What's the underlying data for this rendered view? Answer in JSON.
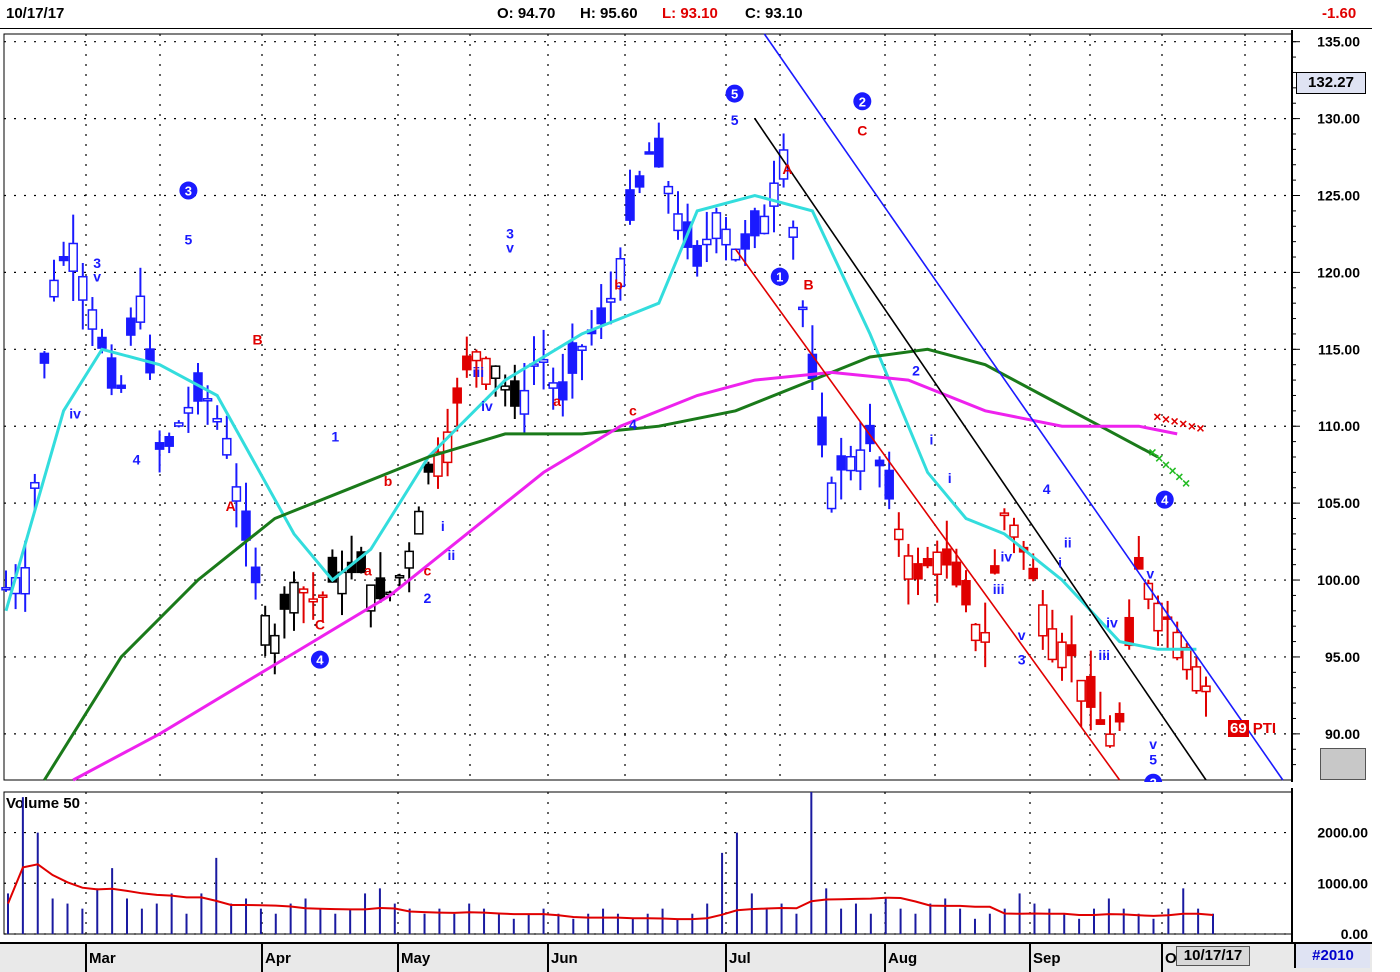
{
  "header": {
    "date": "10/17/17",
    "open": "O: 94.70",
    "high": "H: 95.60",
    "low": "L: 93.10",
    "close": "C: 93.10",
    "change": "-1.60"
  },
  "price_tag": "132.27",
  "ticker": {
    "num": "69",
    "symbol": "PTI"
  },
  "volume_label": "Volume 50",
  "footer": {
    "date": "10/17/17",
    "id": "#2010"
  },
  "colors": {
    "up_bar": "#1a1aff",
    "down_bar": "#e00000",
    "neutral_bar": "#000000",
    "sma_fast": "#33dddd",
    "sma_mid": "#1a7a1a",
    "sma_slow": "#ee22ee",
    "channel_upper": "#1a1aff",
    "channel_mid": "#000000",
    "channel_lower": "#e00000"
  },
  "chart_data": [
    {
      "type": "candlestick",
      "title": "",
      "x_months": [
        "Mar",
        "Apr",
        "May",
        "Jun",
        "Jul",
        "Aug",
        "Sep",
        "O"
      ],
      "y_ticks": [
        "135.00",
        "130.00",
        "125.00",
        "120.00",
        "115.00",
        "110.00",
        "105.00",
        "100.00",
        "95.00",
        "90.00"
      ],
      "ylim": [
        87,
        135.5
      ],
      "grid": true,
      "close_series": [
        {
          "date": "2017-02-15",
          "close": 99.5
        },
        {
          "date": "2017-02-22",
          "close": 101
        },
        {
          "date": "2017-03-01",
          "close": 119
        },
        {
          "date": "2017-03-08",
          "close": 122
        },
        {
          "date": "2017-03-15",
          "close": 117
        },
        {
          "date": "2017-03-22",
          "close": 111
        },
        {
          "date": "2017-03-29",
          "close": 119
        },
        {
          "date": "2017-04-03",
          "close": 107.5
        },
        {
          "date": "2017-04-06",
          "close": 111
        },
        {
          "date": "2017-04-10",
          "close": 112
        },
        {
          "date": "2017-04-14",
          "close": 109
        },
        {
          "date": "2017-04-20",
          "close": 101
        },
        {
          "date": "2017-04-24",
          "close": 96
        },
        {
          "date": "2017-04-28",
          "close": 100
        },
        {
          "date": "2017-05-02",
          "close": 98.5
        },
        {
          "date": "2017-05-08",
          "close": 100.5
        },
        {
          "date": "2017-05-12",
          "close": 100.5
        },
        {
          "date": "2017-05-18",
          "close": 98.5
        },
        {
          "date": "2017-05-22",
          "close": 101
        },
        {
          "date": "2017-05-26",
          "close": 107
        },
        {
          "date": "2017-05-31",
          "close": 110
        },
        {
          "date": "2017-06-05",
          "close": 115
        },
        {
          "date": "2017-06-12",
          "close": 114
        },
        {
          "date": "2017-06-16",
          "close": 111
        },
        {
          "date": "2017-06-22",
          "close": 115
        },
        {
          "date": "2017-06-28",
          "close": 111.5
        },
        {
          "date": "2017-07-05",
          "close": 115.5
        },
        {
          "date": "2017-07-10",
          "close": 117
        },
        {
          "date": "2017-07-14",
          "close": 123
        },
        {
          "date": "2017-07-18",
          "close": 128
        },
        {
          "date": "2017-07-21",
          "close": 125
        },
        {
          "date": "2017-07-25",
          "close": 120
        },
        {
          "date": "2017-07-28",
          "close": 124
        },
        {
          "date": "2017-08-02",
          "close": 121
        },
        {
          "date": "2017-08-07",
          "close": 123
        },
        {
          "date": "2017-08-10",
          "close": 128
        },
        {
          "date": "2017-08-12",
          "close": 116
        },
        {
          "date": "2017-08-16",
          "close": 106
        },
        {
          "date": "2017-08-20",
          "close": 108
        },
        {
          "date": "2017-08-24",
          "close": 109
        },
        {
          "date": "2017-08-28",
          "close": 104
        },
        {
          "date": "2017-09-01",
          "close": 100
        },
        {
          "date": "2017-09-06",
          "close": 102
        },
        {
          "date": "2017-09-10",
          "close": 99
        },
        {
          "date": "2017-09-14",
          "close": 96
        },
        {
          "date": "2017-09-18",
          "close": 105
        },
        {
          "date": "2017-09-22",
          "close": 101
        },
        {
          "date": "2017-09-26",
          "close": 97
        },
        {
          "date": "2017-09-30",
          "close": 95
        },
        {
          "date": "2017-10-03",
          "close": 91
        },
        {
          "date": "2017-10-06",
          "close": 89.5
        },
        {
          "date": "2017-10-09",
          "close": 101
        },
        {
          "date": "2017-10-12",
          "close": 98
        },
        {
          "date": "2017-10-15",
          "close": 96
        },
        {
          "date": "2017-10-17",
          "close": 93.1
        }
      ],
      "moving_averages": [
        {
          "color": "#33dddd",
          "points": [
            [
              0,
              98
            ],
            [
              6,
              111
            ],
            [
              10,
              115
            ],
            [
              16,
              114
            ],
            [
              22,
              112
            ],
            [
              30,
              103
            ],
            [
              34,
              100
            ],
            [
              38,
              102
            ],
            [
              44,
              108
            ],
            [
              52,
              113
            ],
            [
              60,
              116
            ],
            [
              68,
              118
            ],
            [
              72,
              124
            ],
            [
              78,
              125
            ],
            [
              84,
              124
            ],
            [
              90,
              116
            ],
            [
              96,
              107
            ],
            [
              100,
              104
            ],
            [
              104,
              103
            ],
            [
              110,
              100
            ],
            [
              116,
              96
            ],
            [
              120,
              95.5
            ],
            [
              124,
              95.5
            ]
          ]
        },
        {
          "color": "#1a7a1a",
          "points": [
            [
              4,
              87
            ],
            [
              12,
              95
            ],
            [
              20,
              100
            ],
            [
              28,
              104
            ],
            [
              36,
              106
            ],
            [
              44,
              108
            ],
            [
              52,
              109.5
            ],
            [
              60,
              109.5
            ],
            [
              68,
              110
            ],
            [
              76,
              111
            ],
            [
              84,
              113
            ],
            [
              90,
              114.5
            ],
            [
              96,
              115
            ],
            [
              102,
              114
            ],
            [
              108,
              112
            ],
            [
              114,
              110
            ],
            [
              120,
              108
            ]
          ]
        },
        {
          "color": "#ee22ee",
          "points": [
            [
              7,
              87
            ],
            [
              16,
              90
            ],
            [
              24,
              93
            ],
            [
              32,
              96
            ],
            [
              40,
              99
            ],
            [
              48,
              103
            ],
            [
              56,
              107
            ],
            [
              64,
              110
            ],
            [
              72,
              112
            ],
            [
              78,
              113
            ],
            [
              86,
              113.5
            ],
            [
              94,
              113
            ],
            [
              102,
              111
            ],
            [
              110,
              110
            ],
            [
              118,
              110
            ],
            [
              122,
              109.5
            ]
          ]
        }
      ],
      "wave_labels": [
        "3",
        "5",
        "3",
        "v",
        "iv",
        "4",
        "B",
        "A",
        "C",
        "4",
        "1",
        "b",
        "a",
        "c",
        "2",
        "i",
        "ii",
        "iii",
        "iv",
        "3",
        "v",
        "a",
        "c",
        "4",
        "b",
        "5",
        "5",
        "A",
        "1",
        "B",
        "2",
        "C",
        "2",
        "i",
        "i",
        "4",
        "ii",
        "iv",
        "iii",
        "v",
        "3",
        "i",
        "iv",
        "iii",
        "4",
        "v",
        "v",
        "5",
        "3"
      ]
    },
    {
      "type": "bar",
      "title": "Volume 50",
      "y_ticks": [
        "2000.00",
        "1000.00",
        "0.00"
      ],
      "ylim": [
        0,
        2800
      ],
      "values_approx": [
        800,
        2700,
        2000,
        700,
        600,
        500,
        900,
        1300,
        700,
        500,
        600,
        800,
        400,
        800,
        1500,
        600,
        700,
        500,
        400,
        600,
        700,
        500,
        400,
        500,
        800,
        900,
        600,
        500,
        400,
        500,
        400,
        600,
        500,
        400,
        300,
        400,
        500,
        400,
        300,
        400,
        500,
        400,
        300,
        400,
        500,
        300,
        400,
        600,
        1600,
        2000,
        800,
        500,
        600,
        400,
        2800,
        900,
        500,
        600,
        400,
        700,
        500,
        400,
        600,
        700,
        500,
        300,
        400,
        500,
        800,
        600,
        500,
        400,
        300,
        500,
        700,
        500,
        400,
        300,
        500,
        900,
        500,
        400
      ],
      "average_color": "#e00000"
    }
  ]
}
